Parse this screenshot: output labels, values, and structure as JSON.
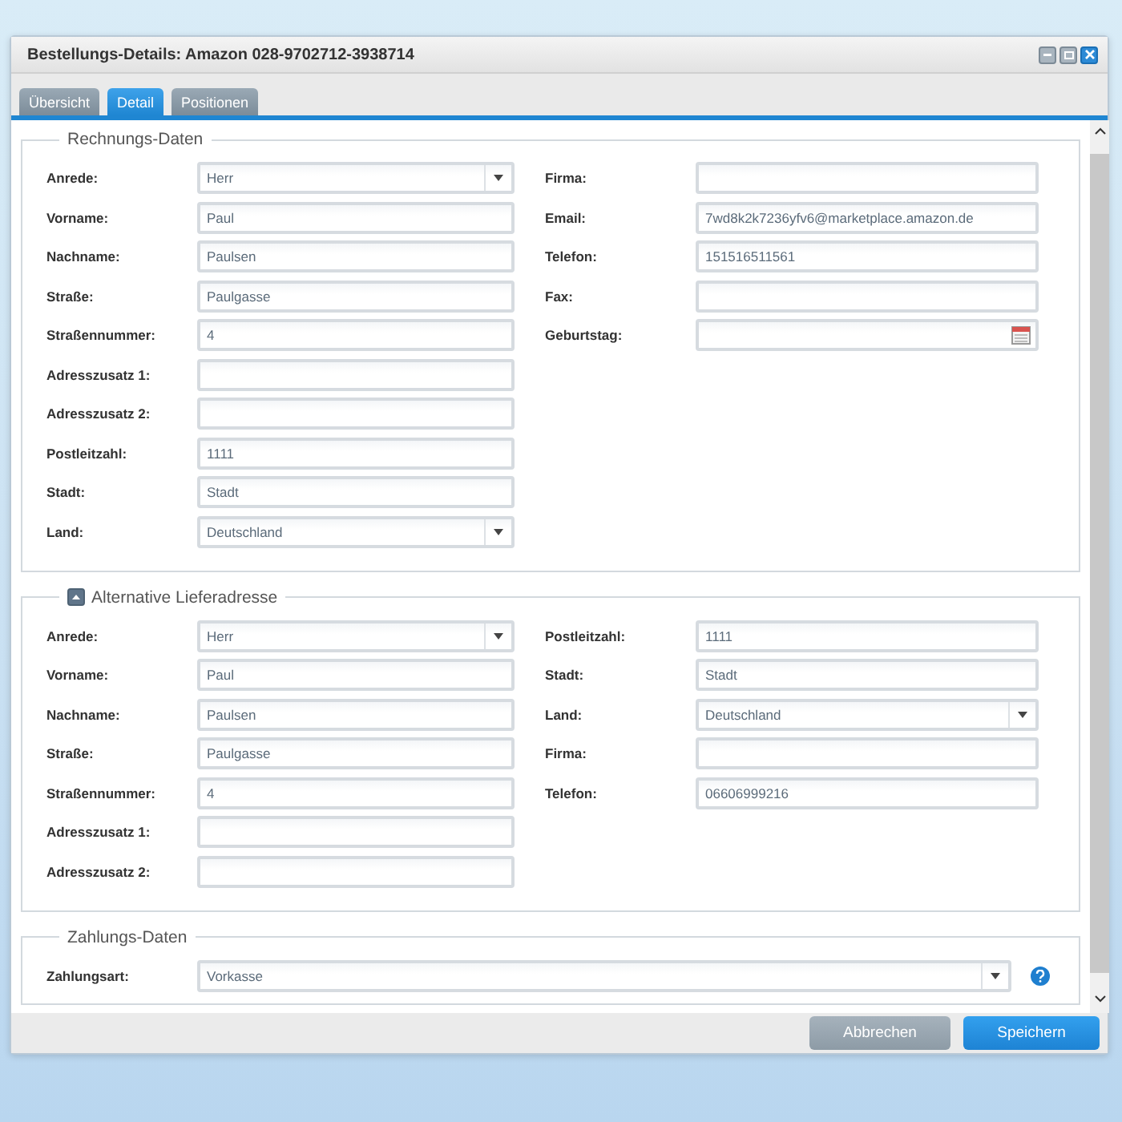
{
  "window": {
    "title": "Bestellungs-Details: Amazon 028-9702712-3938714"
  },
  "tabs": [
    {
      "label": "Übersicht",
      "selected": false
    },
    {
      "label": "Detail",
      "selected": true
    },
    {
      "label": "Positionen",
      "selected": false
    }
  ],
  "sections": [
    {
      "title": "Rechnungs-Daten",
      "collapsible": false,
      "left": [
        {
          "label": "Anrede:",
          "kind": "select",
          "value": "Herr"
        },
        {
          "label": "Vorname:",
          "kind": "text",
          "value": "Paul"
        },
        {
          "label": "Nachname:",
          "kind": "text",
          "value": "Paulsen"
        },
        {
          "label": "Straße:",
          "kind": "text",
          "value": "Paulgasse"
        },
        {
          "label": "Straßennummer:",
          "kind": "text",
          "value": "4"
        },
        {
          "label": "Adresszusatz 1:",
          "kind": "text"
        },
        {
          "label": "Adresszusatz 2:",
          "kind": "text"
        },
        {
          "label": "Postleitzahl:",
          "kind": "text",
          "value": "1111"
        },
        {
          "label": "Stadt:",
          "kind": "text",
          "value": "Stadt"
        },
        {
          "label": "Land:",
          "kind": "select",
          "value": "Deutschland"
        }
      ],
      "right": [
        {
          "label": "Firma:",
          "kind": "text"
        },
        {
          "label": "Email:",
          "kind": "text",
          "value": "7wd8k2k7236yfv6@marketplace.amazon.de"
        },
        {
          "label": "Telefon:",
          "kind": "text",
          "value": "151516511561"
        },
        {
          "label": "Fax:",
          "kind": "text"
        },
        {
          "label": "Geburtstag:",
          "kind": "date"
        }
      ]
    },
    {
      "title": "Alternative Lieferadresse",
      "collapsible": true,
      "expanded": true,
      "left": [
        {
          "label": "Anrede:",
          "kind": "select",
          "value": "Herr"
        },
        {
          "label": "Vorname:",
          "kind": "text",
          "value": "Paul"
        },
        {
          "label": "Nachname:",
          "kind": "text",
          "value": "Paulsen"
        },
        {
          "label": "Straße:",
          "kind": "text",
          "value": "Paulgasse"
        },
        {
          "label": "Straßennummer:",
          "kind": "text",
          "value": "4"
        },
        {
          "label": "Adresszusatz 1:",
          "kind": "text"
        },
        {
          "label": "Adresszusatz 2:",
          "kind": "text"
        }
      ],
      "right": [
        {
          "label": "Postleitzahl:",
          "kind": "text",
          "value": "1111"
        },
        {
          "label": "Stadt:",
          "kind": "text",
          "value": "Stadt"
        },
        {
          "label": "Land:",
          "kind": "select",
          "value": "Deutschland"
        },
        {
          "label": "Firma:",
          "kind": "text"
        },
        {
          "label": "Telefon:",
          "kind": "text",
          "value": "06606999216"
        }
      ]
    }
  ],
  "payment": {
    "title": "Zahlungs-Daten",
    "label": "Zahlungsart:",
    "kind": "select",
    "value": "Vorkasse"
  },
  "buttons": [
    {
      "label": "Abbrechen",
      "kind": "secondary"
    },
    {
      "label": "Speichern",
      "kind": "primary"
    }
  ]
}
